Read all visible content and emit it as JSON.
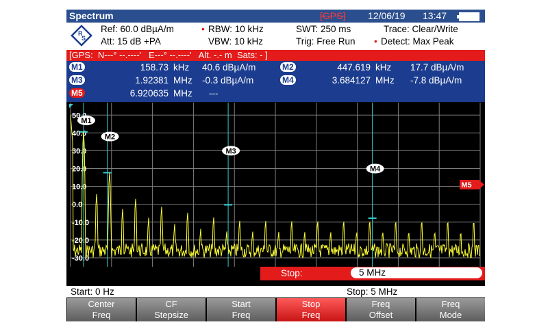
{
  "title": "Spectrum",
  "status": {
    "gps": "[GPS]",
    "date": "12/06/19",
    "time": "13:47"
  },
  "info": {
    "ref": "Ref: 60.0 dBµA/m",
    "att": "Att: 15 dB +PA",
    "rbw": "RBW: 10 kHz",
    "vbw": "VBW: 10 kHz",
    "swt": "SWT: 250 ms",
    "trig": "Trig: Free Run",
    "trace": "Trace: Clear/Write",
    "detect": "Detect: Max Peak"
  },
  "gps_line": "[GPS:  N---° --.----'   E---° --.----'   Alt. -.- m  Sats: - ]",
  "markers": [
    {
      "id": "M1",
      "freq": "158.73",
      "unit": "kHz",
      "level": "40.6 dBµA/m"
    },
    {
      "id": "M2",
      "freq": "447.619",
      "unit": "kHz",
      "level": "17.7 dBµA/m"
    },
    {
      "id": "M3",
      "freq": "1.92381",
      "unit": "MHz",
      "level": "-0.3 dBµA/m"
    },
    {
      "id": "M4",
      "freq": "3.684127",
      "unit": "MHz",
      "level": "-7.8 dBµA/m"
    },
    {
      "id": "M5",
      "freq": "6.920635",
      "unit": "MHz",
      "level": "---"
    }
  ],
  "chart_data": {
    "type": "line",
    "y_tick_labels": [
      "50.0",
      "40.0",
      "30.0",
      "20.0",
      "10.0",
      "0.0",
      "-10.0",
      "-20.0",
      "-30.0"
    ],
    "ylim": [
      -35,
      57
    ],
    "xlim_mhz": [
      0,
      5
    ],
    "marker_positions_mhz": [
      0.15873,
      0.447619,
      1.92381,
      3.684127
    ],
    "marker_levels": [
      40.6,
      17.7,
      -0.3,
      -7.8
    ],
    "offscreen_marker": "M5",
    "fundamental_khz": 158.73,
    "grid": true
  },
  "stop_field": {
    "label": "Stop:",
    "value": "5 MHz"
  },
  "start_label": "Start:  0 Hz",
  "stop_label": "Stop: 5 MHz",
  "softkeys": [
    {
      "l1": "Center",
      "l2": "Freq"
    },
    {
      "l1": "CF",
      "l2": "Stepsize"
    },
    {
      "l1": "Start",
      "l2": "Freq"
    },
    {
      "l1": "Stop",
      "l2": "Freq"
    },
    {
      "l1": "Freq",
      "l2": "Offset"
    },
    {
      "l1": "Freq",
      "l2": "Mode"
    }
  ],
  "colors": {
    "header": "#2b4f8e",
    "marker_bg": "#1c3d8f",
    "alert": "#e31b1b",
    "trace": "#ffff33",
    "grid": "#7f7f7f",
    "marker_line": "#33cccc"
  }
}
